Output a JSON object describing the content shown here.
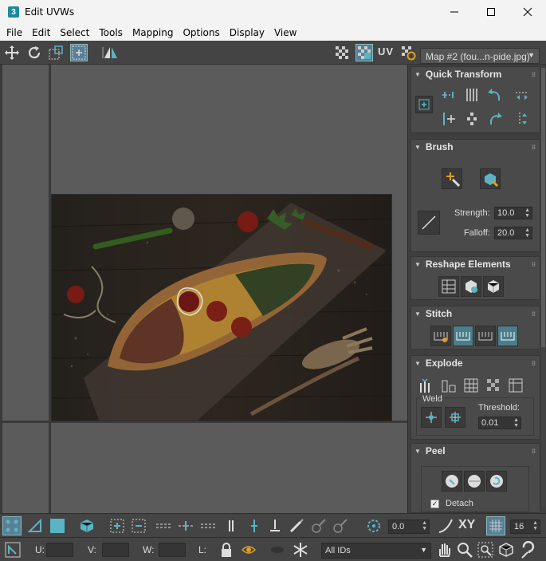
{
  "window": {
    "title": "Edit UVWs",
    "app_icon": "3"
  },
  "menu": [
    "File",
    "Edit",
    "Select",
    "Tools",
    "Mapping",
    "Options",
    "Display",
    "View"
  ],
  "toolbar": {
    "uv_label": "UV",
    "map_selector": "Map #2 (fou...n-pide.jpg)"
  },
  "panel": {
    "quick_transform": {
      "title": "Quick Transform"
    },
    "brush": {
      "title": "Brush",
      "strength_label": "Strength:",
      "strength_value": "10.0",
      "falloff_label": "Falloff:",
      "falloff_value": "20.0"
    },
    "reshape": {
      "title": "Reshape Elements"
    },
    "stitch": {
      "title": "Stitch"
    },
    "explode": {
      "title": "Explode",
      "weld_label": "Weld",
      "threshold_label": "Threshold:",
      "threshold_value": "0.01"
    },
    "peel": {
      "title": "Peel",
      "detach_label": "Detach"
    }
  },
  "bottom": {
    "angle_value": "0.0",
    "xy_label": "XY",
    "grid_value": "16",
    "u_label": "U:",
    "v_label": "V:",
    "w_label": "W:",
    "l_label": "L:",
    "ids_selector": "All IDs"
  },
  "colors": {
    "accent": "#5ab4c4",
    "panel_bg": "#4a4a4a",
    "viewport_bg": "#5b5b5b"
  }
}
